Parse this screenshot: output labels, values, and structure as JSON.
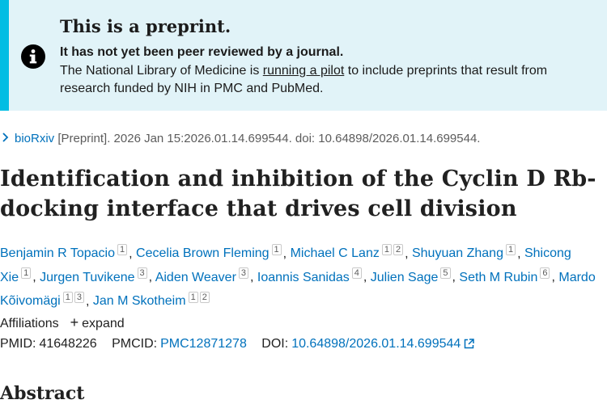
{
  "banner": {
    "title": "This is a preprint.",
    "subtitle": "It has not yet been peer reviewed by a journal.",
    "body_before": "The National Library of Medicine is ",
    "link": "running a pilot",
    "body_after": " to include preprints that result from research funded by NIH in PMC and PubMed.",
    "icon": "info-icon"
  },
  "source": {
    "journal": "bioRxiv",
    "details": " [Preprint]. 2026 Jan 15:2026.01.14.699544. doi: 10.64898/2026.01.14.699544."
  },
  "title": "Identification and inhibition of the Cyclin D Rb-docking interface that drives cell division",
  "authors": [
    {
      "name": "Benjamin R Topacio",
      "aff": [
        "1"
      ]
    },
    {
      "name": "Cecelia Brown Fleming",
      "aff": [
        "1"
      ]
    },
    {
      "name": "Michael C Lanz",
      "aff": [
        "1",
        "2"
      ]
    },
    {
      "name": "Shuyuan Zhang",
      "aff": [
        "1"
      ]
    },
    {
      "name": "Shicong Xie",
      "aff": [
        "1"
      ]
    },
    {
      "name": "Jurgen Tuvikene",
      "aff": [
        "3"
      ]
    },
    {
      "name": "Aiden Weaver",
      "aff": [
        "3"
      ]
    },
    {
      "name": "Ioannis Sanidas",
      "aff": [
        "4"
      ]
    },
    {
      "name": "Julien Sage",
      "aff": [
        "5"
      ]
    },
    {
      "name": "Seth M Rubin",
      "aff": [
        "6"
      ]
    },
    {
      "name": "Mardo Kõivomägi",
      "aff": [
        "1",
        "3"
      ]
    },
    {
      "name": "Jan M Skotheim",
      "aff": [
        "1",
        "2"
      ]
    }
  ],
  "affiliations": {
    "label": "Affiliations",
    "toggle": "expand"
  },
  "ids": {
    "pmid_label": "PMID:",
    "pmid": "41648226",
    "pmcid_label": "PMCID:",
    "pmcid": "PMC12871278",
    "doi_label": "DOI:",
    "doi": "10.64898/2026.01.14.699544"
  },
  "abstract_heading": "Abstract"
}
